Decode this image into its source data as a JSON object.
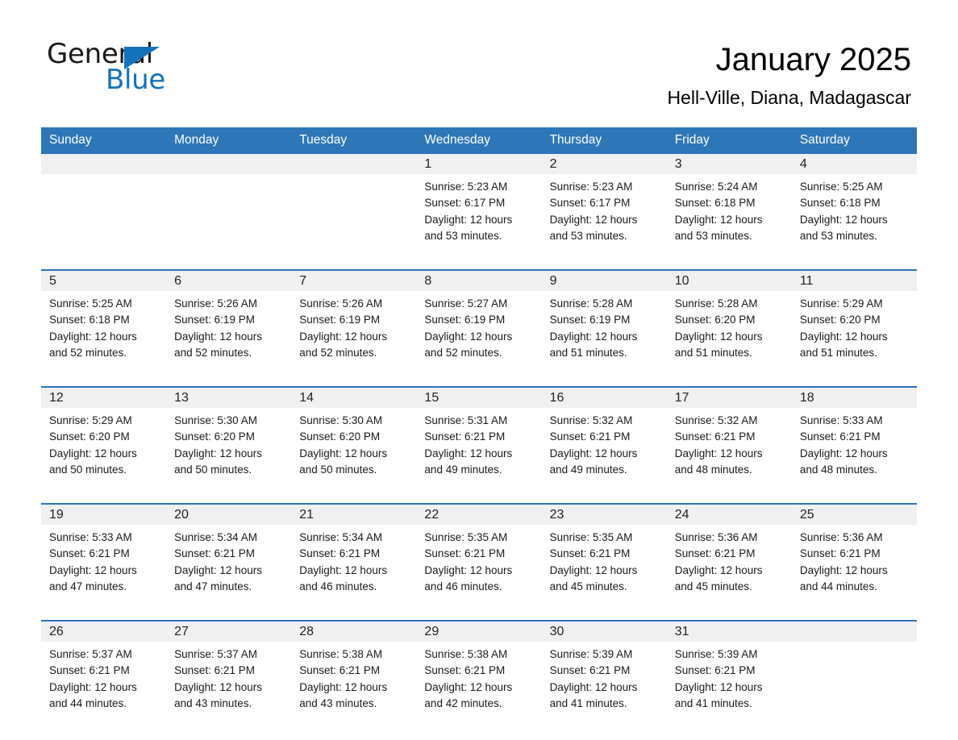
{
  "brand": {
    "name_part1": "General",
    "name_part2": "Blue",
    "accent_color": "#1472bb"
  },
  "header": {
    "title": "January 2025",
    "subtitle": "Hell-Ville, Diana, Madagascar"
  },
  "theme": {
    "header_blue": "#2d76b8",
    "daynum_gray": "#f0f0f0",
    "separator_blue": "#2d76b8"
  },
  "weekday_headers": [
    "Sunday",
    "Monday",
    "Tuesday",
    "Wednesday",
    "Thursday",
    "Friday",
    "Saturday"
  ],
  "weeks": [
    [
      {
        "day": "",
        "empty": true
      },
      {
        "day": "",
        "empty": true
      },
      {
        "day": "",
        "empty": true
      },
      {
        "day": "1",
        "sunrise": "Sunrise: 5:23 AM",
        "sunset": "Sunset: 6:17 PM",
        "daylight_line1": "Daylight: 12 hours",
        "daylight_line2": "and 53 minutes."
      },
      {
        "day": "2",
        "sunrise": "Sunrise: 5:23 AM",
        "sunset": "Sunset: 6:17 PM",
        "daylight_line1": "Daylight: 12 hours",
        "daylight_line2": "and 53 minutes."
      },
      {
        "day": "3",
        "sunrise": "Sunrise: 5:24 AM",
        "sunset": "Sunset: 6:18 PM",
        "daylight_line1": "Daylight: 12 hours",
        "daylight_line2": "and 53 minutes."
      },
      {
        "day": "4",
        "sunrise": "Sunrise: 5:25 AM",
        "sunset": "Sunset: 6:18 PM",
        "daylight_line1": "Daylight: 12 hours",
        "daylight_line2": "and 53 minutes."
      }
    ],
    [
      {
        "day": "5",
        "sunrise": "Sunrise: 5:25 AM",
        "sunset": "Sunset: 6:18 PM",
        "daylight_line1": "Daylight: 12 hours",
        "daylight_line2": "and 52 minutes."
      },
      {
        "day": "6",
        "sunrise": "Sunrise: 5:26 AM",
        "sunset": "Sunset: 6:19 PM",
        "daylight_line1": "Daylight: 12 hours",
        "daylight_line2": "and 52 minutes."
      },
      {
        "day": "7",
        "sunrise": "Sunrise: 5:26 AM",
        "sunset": "Sunset: 6:19 PM",
        "daylight_line1": "Daylight: 12 hours",
        "daylight_line2": "and 52 minutes."
      },
      {
        "day": "8",
        "sunrise": "Sunrise: 5:27 AM",
        "sunset": "Sunset: 6:19 PM",
        "daylight_line1": "Daylight: 12 hours",
        "daylight_line2": "and 52 minutes."
      },
      {
        "day": "9",
        "sunrise": "Sunrise: 5:28 AM",
        "sunset": "Sunset: 6:19 PM",
        "daylight_line1": "Daylight: 12 hours",
        "daylight_line2": "and 51 minutes."
      },
      {
        "day": "10",
        "sunrise": "Sunrise: 5:28 AM",
        "sunset": "Sunset: 6:20 PM",
        "daylight_line1": "Daylight: 12 hours",
        "daylight_line2": "and 51 minutes."
      },
      {
        "day": "11",
        "sunrise": "Sunrise: 5:29 AM",
        "sunset": "Sunset: 6:20 PM",
        "daylight_line1": "Daylight: 12 hours",
        "daylight_line2": "and 51 minutes."
      }
    ],
    [
      {
        "day": "12",
        "sunrise": "Sunrise: 5:29 AM",
        "sunset": "Sunset: 6:20 PM",
        "daylight_line1": "Daylight: 12 hours",
        "daylight_line2": "and 50 minutes."
      },
      {
        "day": "13",
        "sunrise": "Sunrise: 5:30 AM",
        "sunset": "Sunset: 6:20 PM",
        "daylight_line1": "Daylight: 12 hours",
        "daylight_line2": "and 50 minutes."
      },
      {
        "day": "14",
        "sunrise": "Sunrise: 5:30 AM",
        "sunset": "Sunset: 6:20 PM",
        "daylight_line1": "Daylight: 12 hours",
        "daylight_line2": "and 50 minutes."
      },
      {
        "day": "15",
        "sunrise": "Sunrise: 5:31 AM",
        "sunset": "Sunset: 6:21 PM",
        "daylight_line1": "Daylight: 12 hours",
        "daylight_line2": "and 49 minutes."
      },
      {
        "day": "16",
        "sunrise": "Sunrise: 5:32 AM",
        "sunset": "Sunset: 6:21 PM",
        "daylight_line1": "Daylight: 12 hours",
        "daylight_line2": "and 49 minutes."
      },
      {
        "day": "17",
        "sunrise": "Sunrise: 5:32 AM",
        "sunset": "Sunset: 6:21 PM",
        "daylight_line1": "Daylight: 12 hours",
        "daylight_line2": "and 48 minutes."
      },
      {
        "day": "18",
        "sunrise": "Sunrise: 5:33 AM",
        "sunset": "Sunset: 6:21 PM",
        "daylight_line1": "Daylight: 12 hours",
        "daylight_line2": "and 48 minutes."
      }
    ],
    [
      {
        "day": "19",
        "sunrise": "Sunrise: 5:33 AM",
        "sunset": "Sunset: 6:21 PM",
        "daylight_line1": "Daylight: 12 hours",
        "daylight_line2": "and 47 minutes."
      },
      {
        "day": "20",
        "sunrise": "Sunrise: 5:34 AM",
        "sunset": "Sunset: 6:21 PM",
        "daylight_line1": "Daylight: 12 hours",
        "daylight_line2": "and 47 minutes."
      },
      {
        "day": "21",
        "sunrise": "Sunrise: 5:34 AM",
        "sunset": "Sunset: 6:21 PM",
        "daylight_line1": "Daylight: 12 hours",
        "daylight_line2": "and 46 minutes."
      },
      {
        "day": "22",
        "sunrise": "Sunrise: 5:35 AM",
        "sunset": "Sunset: 6:21 PM",
        "daylight_line1": "Daylight: 12 hours",
        "daylight_line2": "and 46 minutes."
      },
      {
        "day": "23",
        "sunrise": "Sunrise: 5:35 AM",
        "sunset": "Sunset: 6:21 PM",
        "daylight_line1": "Daylight: 12 hours",
        "daylight_line2": "and 45 minutes."
      },
      {
        "day": "24",
        "sunrise": "Sunrise: 5:36 AM",
        "sunset": "Sunset: 6:21 PM",
        "daylight_line1": "Daylight: 12 hours",
        "daylight_line2": "and 45 minutes."
      },
      {
        "day": "25",
        "sunrise": "Sunrise: 5:36 AM",
        "sunset": "Sunset: 6:21 PM",
        "daylight_line1": "Daylight: 12 hours",
        "daylight_line2": "and 44 minutes."
      }
    ],
    [
      {
        "day": "26",
        "sunrise": "Sunrise: 5:37 AM",
        "sunset": "Sunset: 6:21 PM",
        "daylight_line1": "Daylight: 12 hours",
        "daylight_line2": "and 44 minutes."
      },
      {
        "day": "27",
        "sunrise": "Sunrise: 5:37 AM",
        "sunset": "Sunset: 6:21 PM",
        "daylight_line1": "Daylight: 12 hours",
        "daylight_line2": "and 43 minutes."
      },
      {
        "day": "28",
        "sunrise": "Sunrise: 5:38 AM",
        "sunset": "Sunset: 6:21 PM",
        "daylight_line1": "Daylight: 12 hours",
        "daylight_line2": "and 43 minutes."
      },
      {
        "day": "29",
        "sunrise": "Sunrise: 5:38 AM",
        "sunset": "Sunset: 6:21 PM",
        "daylight_line1": "Daylight: 12 hours",
        "daylight_line2": "and 42 minutes."
      },
      {
        "day": "30",
        "sunrise": "Sunrise: 5:39 AM",
        "sunset": "Sunset: 6:21 PM",
        "daylight_line1": "Daylight: 12 hours",
        "daylight_line2": "and 41 minutes."
      },
      {
        "day": "31",
        "sunrise": "Sunrise: 5:39 AM",
        "sunset": "Sunset: 6:21 PM",
        "daylight_line1": "Daylight: 12 hours",
        "daylight_line2": "and 41 minutes."
      },
      {
        "day": "",
        "empty": true
      }
    ]
  ]
}
